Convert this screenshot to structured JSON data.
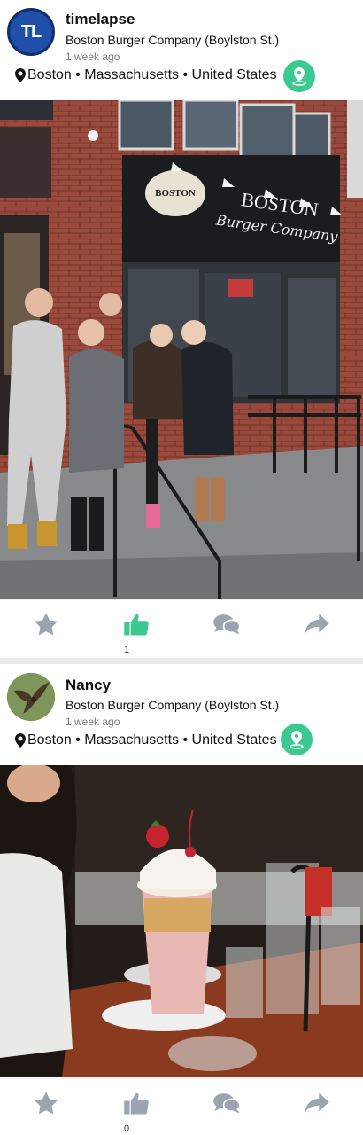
{
  "colors": {
    "accent": "#3cc990",
    "icon_gray": "#9aa5b1",
    "like_active": "#3cc990"
  },
  "posts": [
    {
      "username": "timelapse",
      "avatar_initials": "TL",
      "place": "Boston Burger Company (Boylston St.)",
      "time": "1 week ago",
      "location": "Boston • Massachusetts • United States",
      "photo": "storefront-group-photo",
      "photo_sign_line1": "BOSTON",
      "photo_sign_line2": "Burger Company",
      "like_count": "1",
      "icons": [
        "star-icon",
        "thumbs-up-icon",
        "chat-bubbles-icon",
        "share-arrow-icon"
      ]
    },
    {
      "username": "Nancy",
      "avatar_image": "bird-in-flight",
      "place": "Boston Burger Company (Boylston St.)",
      "time": "1 week ago",
      "location": "Boston • Massachusetts • United States",
      "photo": "milkshake-photo",
      "like_count": "0",
      "icons": [
        "star-icon",
        "thumbs-up-icon",
        "chat-bubbles-icon",
        "share-arrow-icon"
      ]
    }
  ]
}
